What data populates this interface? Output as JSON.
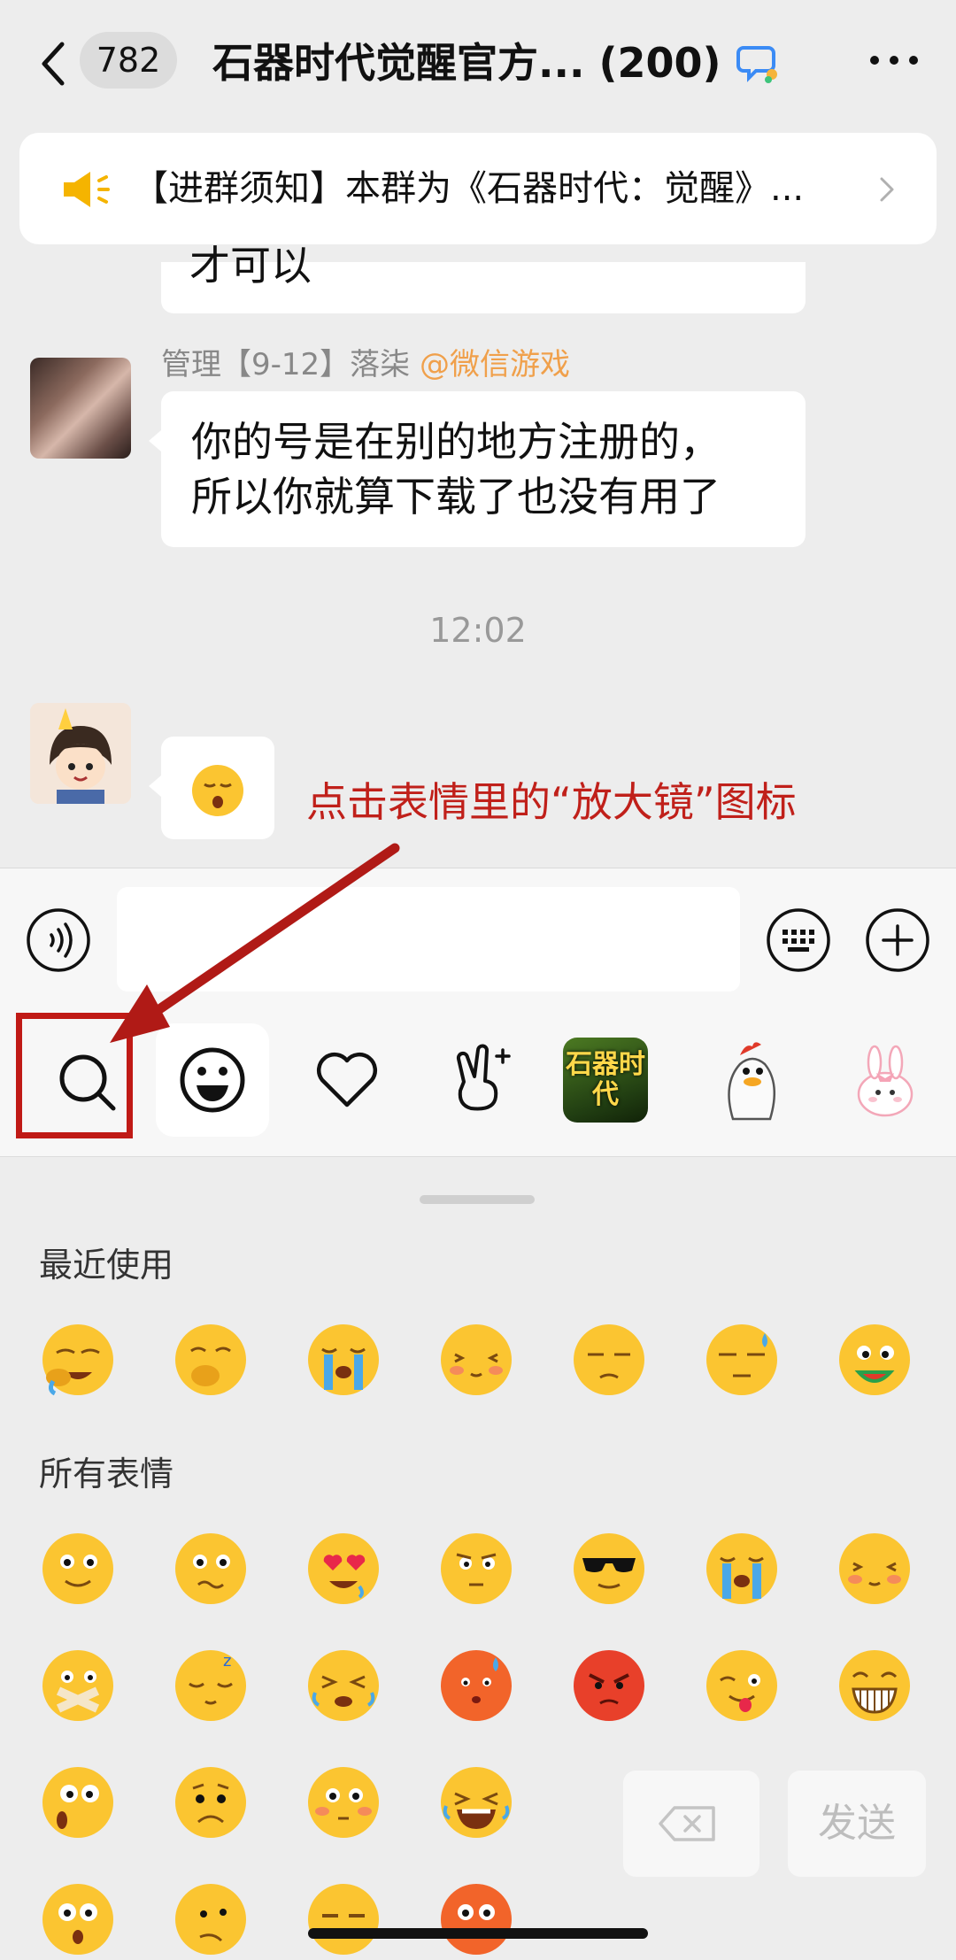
{
  "header": {
    "unread_count": "782",
    "title": "石器时代觉醒官方... (200)"
  },
  "notice": {
    "text": "【进群须知】本群为《石器时代：觉醒》..."
  },
  "messages": [
    {
      "text": "才可以"
    },
    {
      "sender": "管理【9-12】落柒",
      "sender_tag": "@微信游戏",
      "text_line1": "你的号是在别的地方注册的，",
      "text_line2": "所以你就算下载了也没有用了"
    },
    {
      "emoji": "sleepy-emoji"
    }
  ],
  "time_separator": "12:02",
  "annotation": {
    "text": "点击表情里的“放大镜”图标",
    "color": "#c0201a"
  },
  "sticker_tabs": [
    {
      "icon": "search-icon"
    },
    {
      "icon": "smiley-icon"
    },
    {
      "icon": "heart-icon"
    },
    {
      "icon": "gesture-icon"
    },
    {
      "label": "石器时代"
    },
    {
      "icon": "duck-sticker"
    },
    {
      "icon": "bunny-sticker"
    }
  ],
  "emoji_panel": {
    "recent_title": "最近使用",
    "all_title": "所有表情",
    "send_label": "发送"
  },
  "colors": {
    "accent_orange": "#f0a04b",
    "annotation_red": "#c0201a",
    "emoji_yellow": "#fbc531"
  }
}
